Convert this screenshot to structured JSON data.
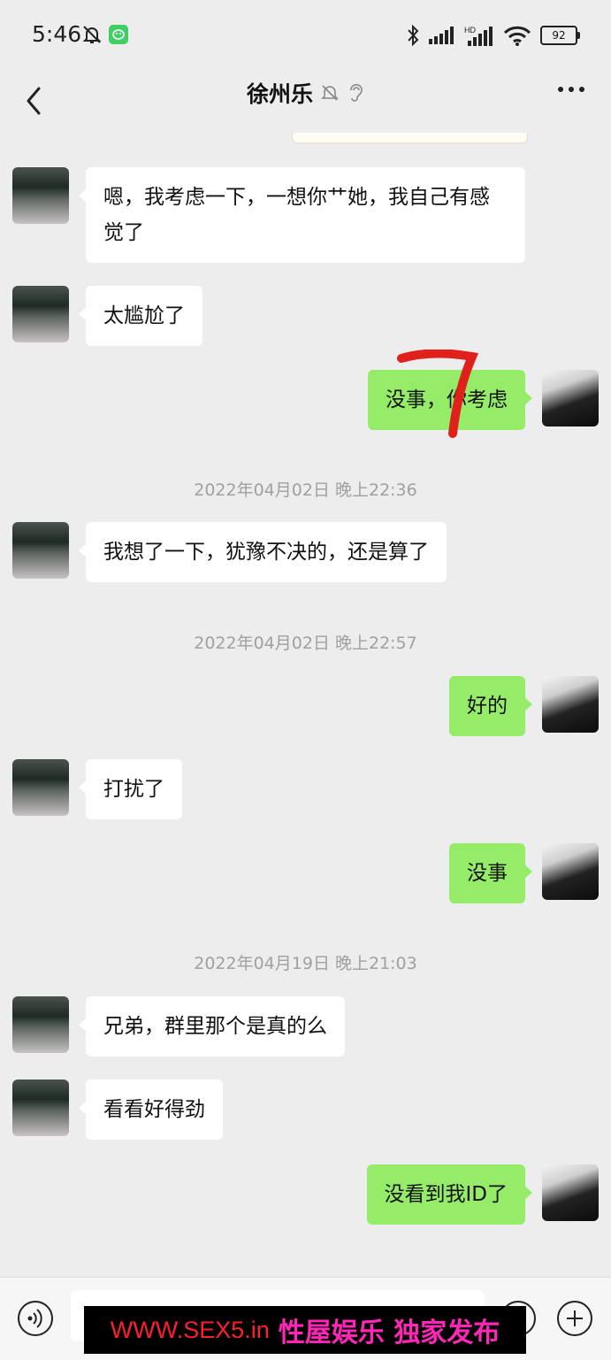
{
  "status_bar": {
    "time": "5:46",
    "battery": "92",
    "icons": [
      "bell-off-icon",
      "wechat-app-icon",
      "bluetooth-icon",
      "signal-icon",
      "hd-signal-icon",
      "wifi-icon",
      "battery-icon"
    ]
  },
  "header": {
    "title": "徐州乐",
    "icons": [
      "back-icon",
      "mute-bell-icon",
      "ear-icon",
      "more-icon"
    ]
  },
  "messages": [
    {
      "side": "in",
      "text": "嗯，我考虑一下，一想你艹她，我自己有感觉了"
    },
    {
      "side": "in",
      "text": "太尴尬了"
    },
    {
      "side": "out",
      "text": "没事，你考虑"
    },
    {
      "side": "time",
      "text": "2022年04月02日 晚上22:36"
    },
    {
      "side": "in",
      "text": "我想了一下，犹豫不决的，还是算了"
    },
    {
      "side": "time",
      "text": "2022年04月02日 晚上22:57"
    },
    {
      "side": "out",
      "text": "好的"
    },
    {
      "side": "in",
      "text": "打扰了"
    },
    {
      "side": "out",
      "text": "没事"
    },
    {
      "side": "time",
      "text": "2022年04月19日 晚上21:03"
    },
    {
      "side": "in",
      "text": "兄弟，群里那个是真的么"
    },
    {
      "side": "in",
      "text": "看看好得劲"
    },
    {
      "side": "out",
      "text": "没看到我ID了"
    }
  ],
  "annotation": {
    "mark": "7",
    "color": "#e0201a"
  },
  "watermark": {
    "site": "WWW.SEX5.in",
    "text": "性屋娱乐 独家发布"
  },
  "colors": {
    "background": "#ededed",
    "outgoing_bubble": "#95ec69",
    "incoming_bubble": "#ffffff"
  }
}
